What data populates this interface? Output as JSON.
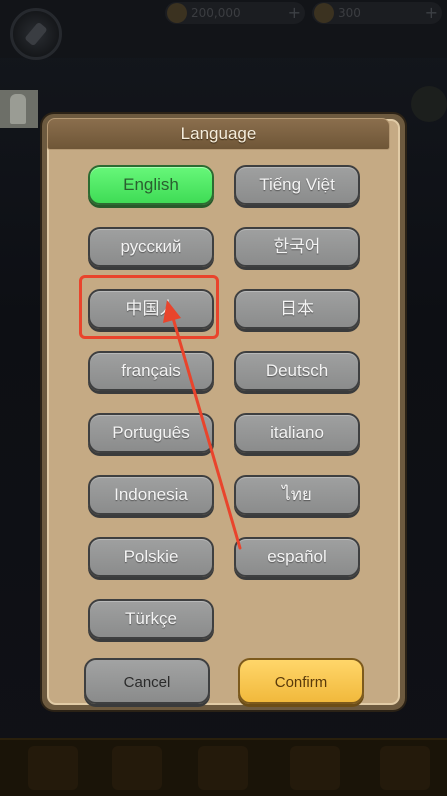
{
  "background": {
    "top_values": [
      "200,000",
      "300"
    ]
  },
  "dialog": {
    "title": "Language",
    "languages": [
      {
        "label": "English",
        "selected": true
      },
      {
        "label": "Tiếng Việt",
        "selected": false
      },
      {
        "label": "русский",
        "selected": false
      },
      {
        "label": "한국어",
        "selected": false
      },
      {
        "label": "中国人",
        "selected": false
      },
      {
        "label": "日本",
        "selected": false
      },
      {
        "label": "français",
        "selected": false
      },
      {
        "label": "Deutsch",
        "selected": false
      },
      {
        "label": "Português",
        "selected": false
      },
      {
        "label": "italiano",
        "selected": false
      },
      {
        "label": "Indonesia",
        "selected": false
      },
      {
        "label": "ไทย",
        "selected": false
      },
      {
        "label": "Polskie",
        "selected": false
      },
      {
        "label": "español",
        "selected": false
      },
      {
        "label": "Türkçe",
        "selected": false
      }
    ],
    "cancel_label": "Cancel",
    "confirm_label": "Confirm"
  },
  "annotation": {
    "highlight_color": "#e9442c",
    "arrow_color": "#e9442c"
  },
  "colors": {
    "selected_green": "#4fe964",
    "confirm_gold": "#f6c64f",
    "panel_tan": "#c5aa84"
  }
}
